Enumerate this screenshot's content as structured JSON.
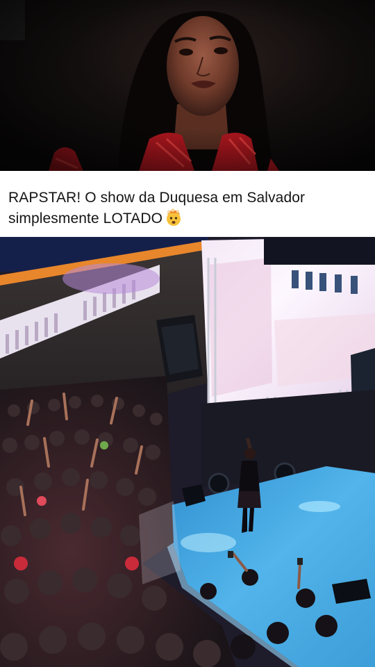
{
  "post": {
    "caption": "RAPSTAR! O show da Duquesa em Salvador simplesmente LOTADO",
    "caption_emoji": "exploding-head-emoji"
  },
  "images": {
    "top_photo": "portrait-photo",
    "concert_photo": "concert-photo"
  },
  "colors": {
    "caption_text": "#141414",
    "background": "#ffffff",
    "stage_blue": "#3fa3df",
    "outfit_red": "#d01f2a"
  }
}
